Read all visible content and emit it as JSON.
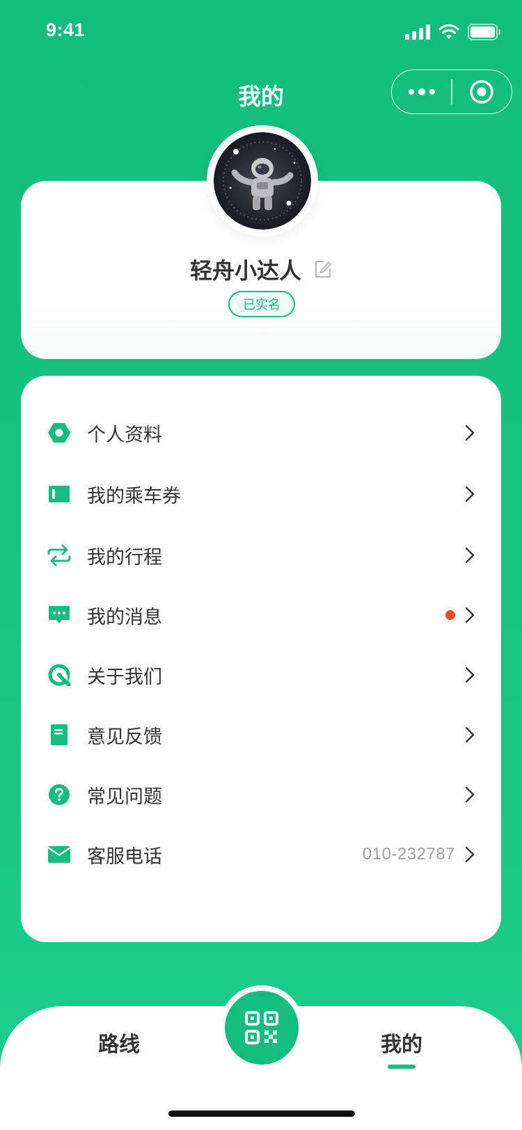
{
  "status_bar": {
    "time": "9:41"
  },
  "header": {
    "title": "我的"
  },
  "profile": {
    "username": "轻舟小达人",
    "badge": "已实名"
  },
  "menu": {
    "items": [
      {
        "label": "个人资料",
        "icon": "hexagon-icon",
        "value": "",
        "dot": false
      },
      {
        "label": "我的乘车券",
        "icon": "ticket-icon",
        "value": "",
        "dot": false
      },
      {
        "label": "我的行程",
        "icon": "swap-arrows-icon",
        "value": "",
        "dot": false
      },
      {
        "label": "我的消息",
        "icon": "message-icon",
        "value": "",
        "dot": true
      },
      {
        "label": "关于我们",
        "icon": "about-logo-icon",
        "value": "",
        "dot": false
      },
      {
        "label": "意见反馈",
        "icon": "document-icon",
        "value": "",
        "dot": false
      },
      {
        "label": "常见问题",
        "icon": "question-icon",
        "value": "",
        "dot": false
      },
      {
        "label": "客服电话",
        "icon": "mail-icon",
        "value": "010-232787",
        "dot": false
      }
    ]
  },
  "tabbar": {
    "left": "路线",
    "right": "我的"
  },
  "colors": {
    "primary": "#16bd81",
    "dot": "#ff4b1f",
    "text": "#333333"
  }
}
